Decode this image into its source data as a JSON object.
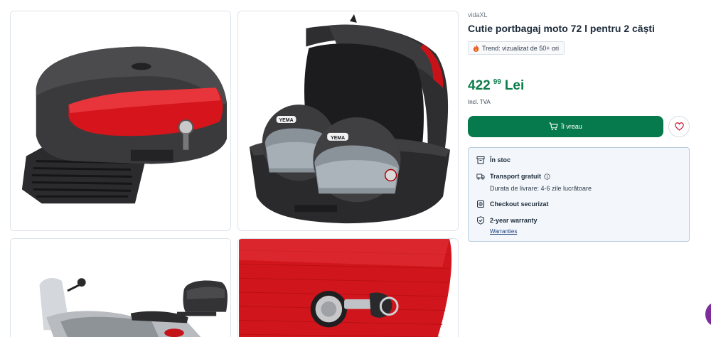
{
  "product": {
    "brand": "vidaXL",
    "title": "Cutie portbagaj moto 72 l pentru 2 căști",
    "trend_label": "Trend: vizualizat de 50+ ori",
    "price_integer": "422",
    "price_decimal": "99",
    "currency": "Lei",
    "vat_note": "Incl. TVA"
  },
  "actions": {
    "buy_label": "Îl vreau"
  },
  "availability": {
    "stock_label": "În stoc",
    "shipping_label": "Transport gratuit",
    "delivery_note": "Durata de livrare: 4-6 zile lucrătoare",
    "checkout_label": "Checkout securizat",
    "warranty_label": "2-year warranty",
    "warranty_link": "Warranties"
  },
  "images": {
    "helmet_brand": "YEMA"
  },
  "colors": {
    "accent_green": "#067a4c",
    "price_green": "#0a7d4a",
    "panel_bg": "#f3f7fc",
    "panel_border": "#b7cbe0"
  },
  "icons": [
    "flame-icon",
    "cart-icon",
    "heart-icon",
    "stock-icon",
    "truck-icon",
    "info-icon",
    "lock-icon",
    "shield-icon",
    "chat-icon"
  ]
}
